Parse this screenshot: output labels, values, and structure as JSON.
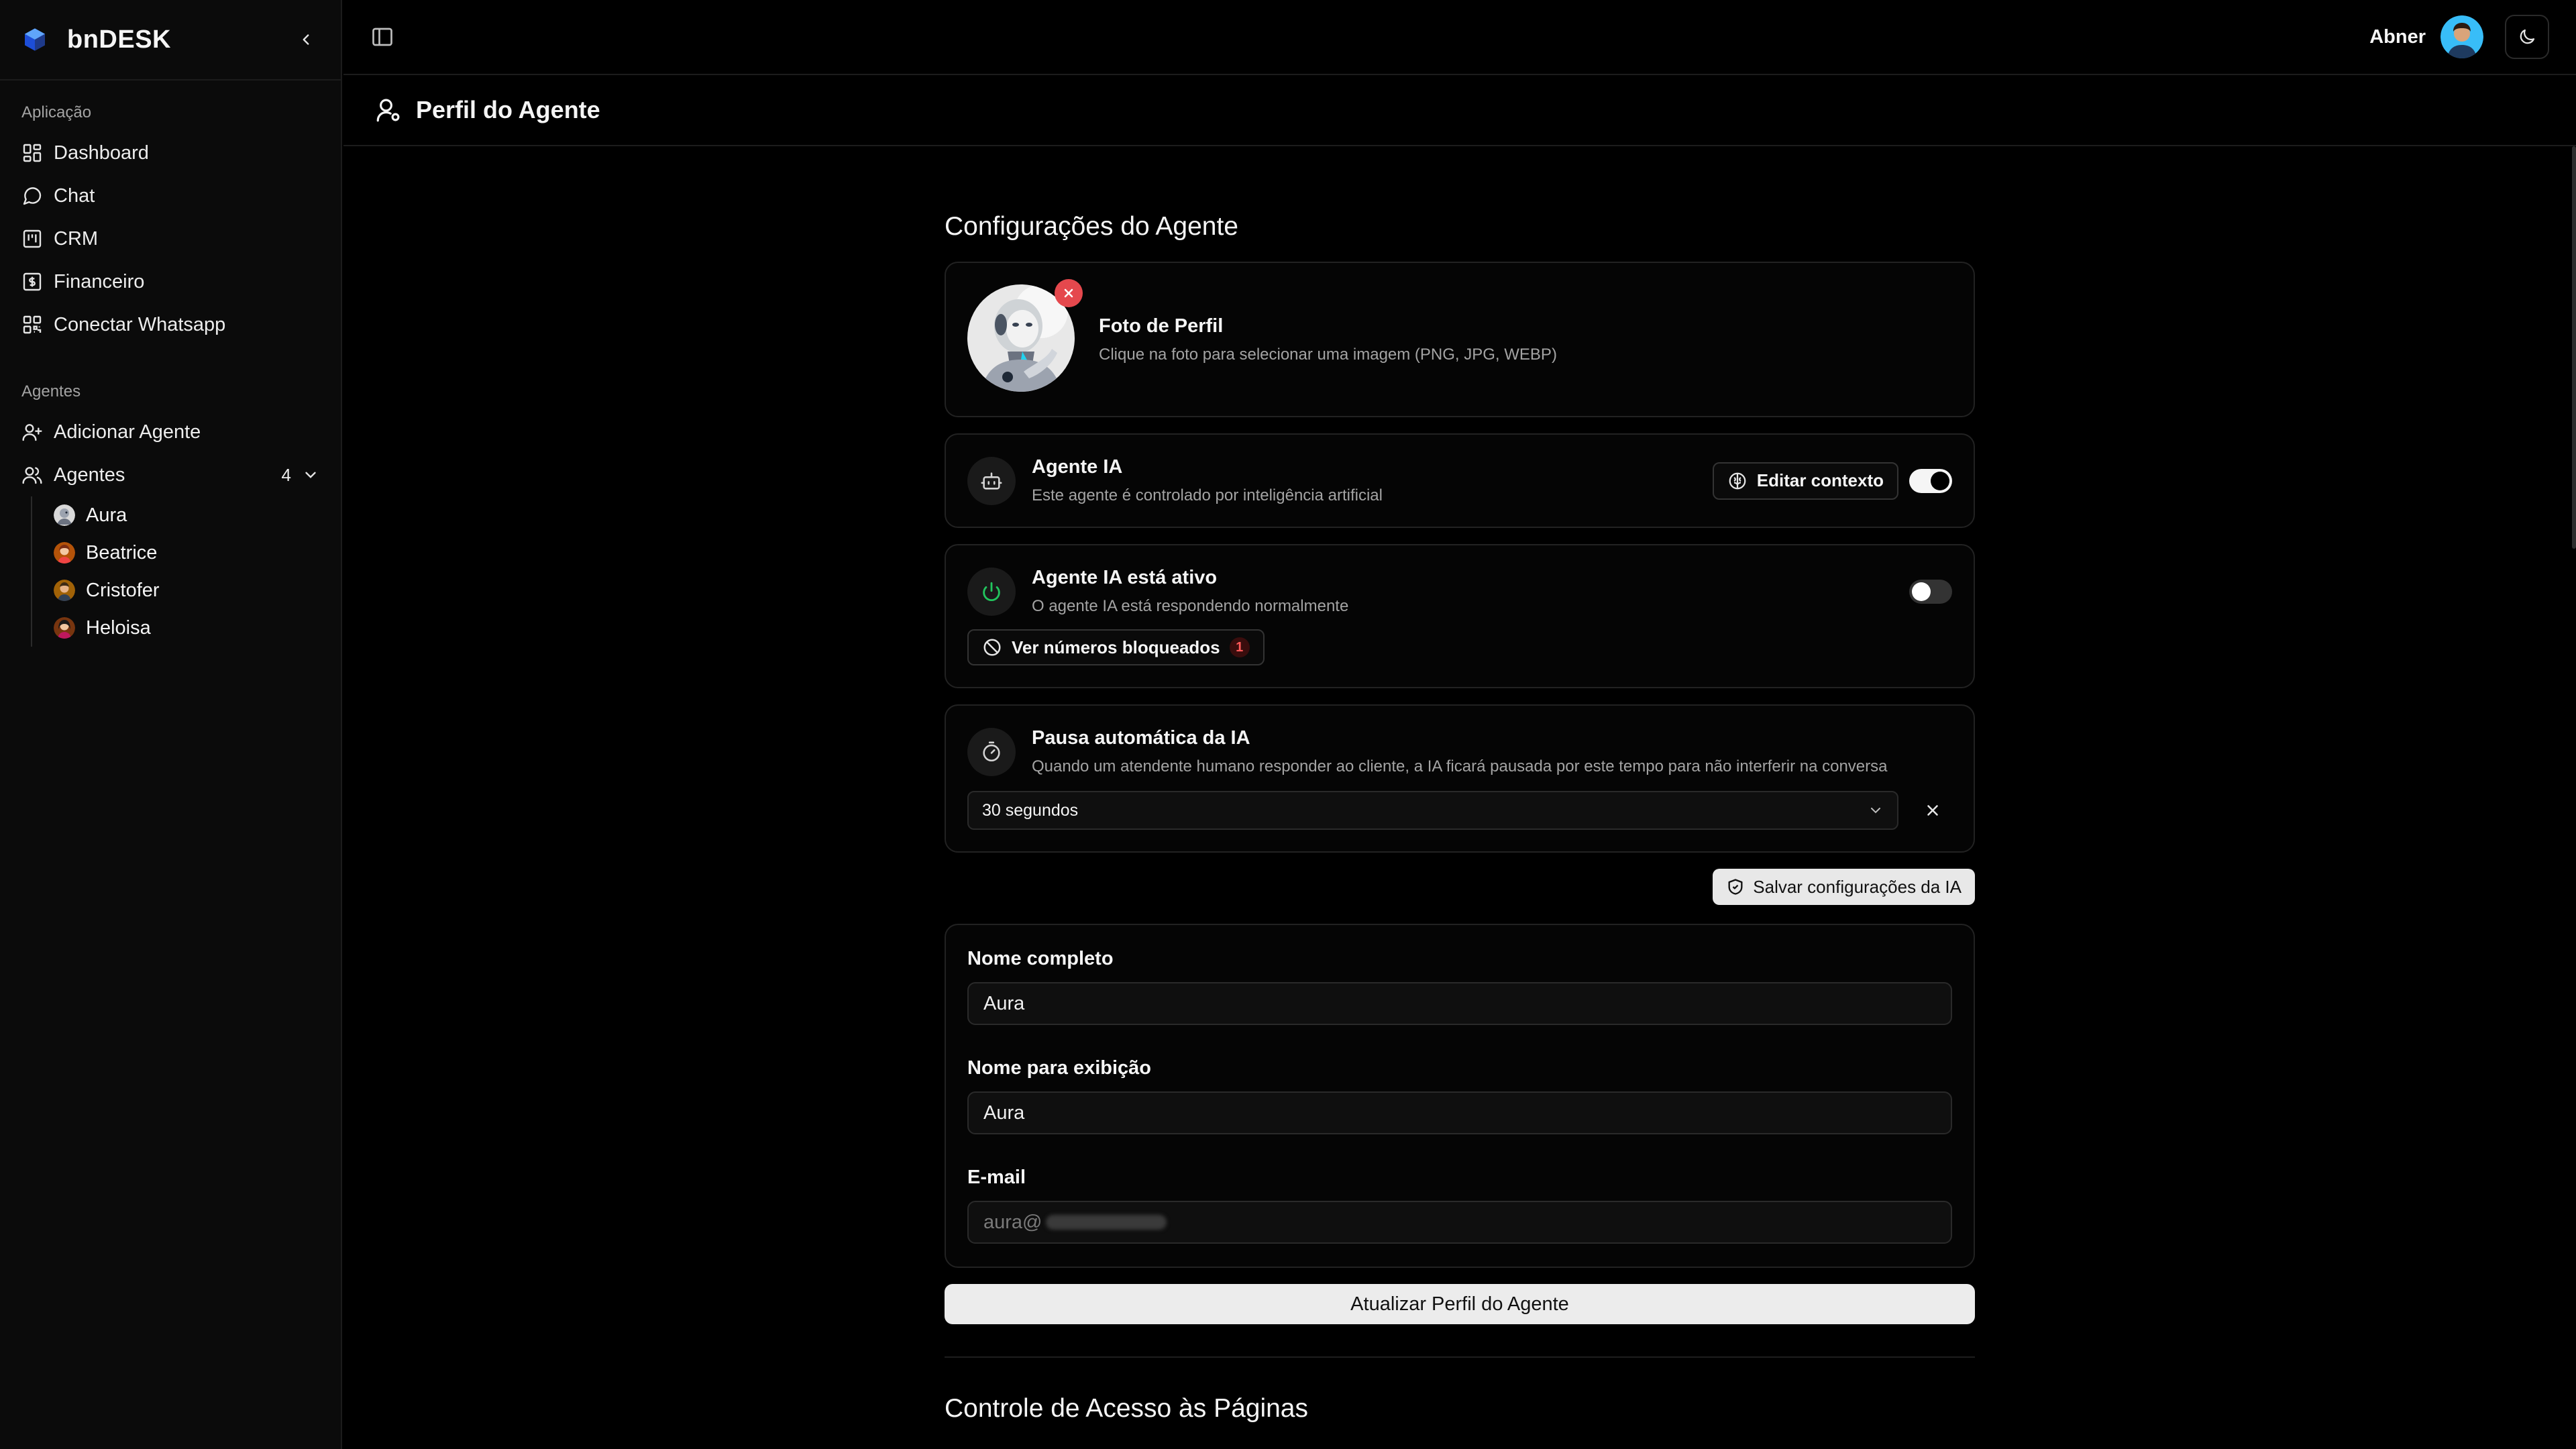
{
  "brand": {
    "name": "bnDESK"
  },
  "sidebar": {
    "section_app": "Aplicação",
    "app_items": [
      {
        "label": "Dashboard",
        "icon": "dashboard-grid-icon"
      },
      {
        "label": "Chat",
        "icon": "chat-bubble-icon"
      },
      {
        "label": "CRM",
        "icon": "kanban-icon"
      },
      {
        "label": "Financeiro",
        "icon": "finance-icon"
      },
      {
        "label": "Conectar Whatsapp",
        "icon": "qrcode-icon"
      }
    ],
    "section_agents": "Agentes",
    "add_agent": "Adicionar Agente",
    "agents_label": "Agentes",
    "agents_count": "4",
    "agents": [
      {
        "name": "Aura"
      },
      {
        "name": "Beatrice"
      },
      {
        "name": "Cristofer"
      },
      {
        "name": "Heloisa"
      }
    ]
  },
  "topbar": {
    "username": "Abner"
  },
  "page": {
    "title": "Perfil do Agente"
  },
  "config": {
    "title": "Configurações do Agente",
    "photo": {
      "title": "Foto de Perfil",
      "subtitle": "Clique na foto para selecionar uma imagem (PNG, JPG, WEBP)"
    },
    "ai_agent": {
      "title": "Agente IA",
      "subtitle": "Este agente é controlado por inteligência artificial",
      "edit_label": "Editar contexto",
      "enabled": true
    },
    "ai_active": {
      "title": "Agente IA está ativo",
      "subtitle": "O agente IA está respondendo normalmente",
      "blocked_label": "Ver números bloqueados",
      "blocked_count": "1",
      "enabled": false
    },
    "auto_pause": {
      "title": "Pausa automática da IA",
      "subtitle": "Quando um atendente humano responder ao cliente, a IA ficará pausada por este tempo para não interferir na conversa",
      "selected": "30 segundos"
    },
    "save_ai_label": "Salvar configurações da IA"
  },
  "profile": {
    "full_name_label": "Nome completo",
    "full_name_value": "Aura",
    "display_name_label": "Nome para exibição",
    "display_name_value": "Aura",
    "email_label": "E-mail",
    "email_value": "aura@",
    "update_label": "Atualizar Perfil do Agente"
  },
  "access": {
    "title": "Controle de Acesso às Páginas"
  },
  "colors": {
    "background": "#000000",
    "danger": "#e5484d",
    "success": "#22c55e"
  }
}
